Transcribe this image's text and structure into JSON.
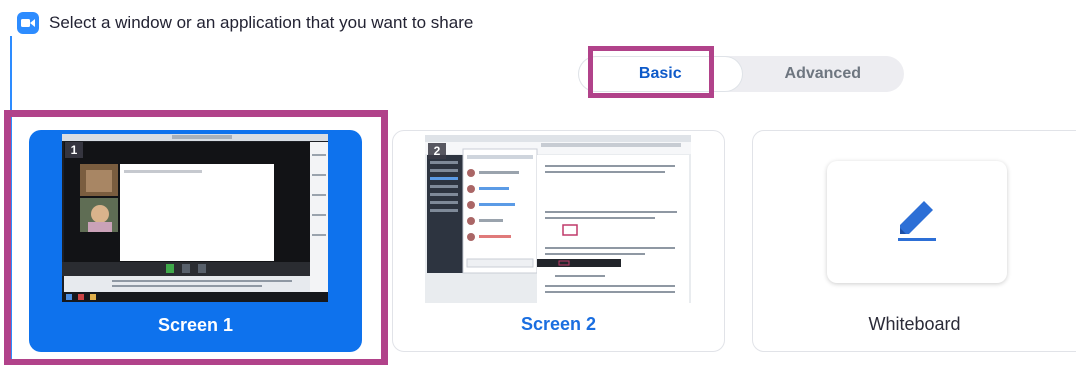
{
  "header": {
    "title": "Select a window or an application that you want to share"
  },
  "tabs": [
    {
      "label": "Basic",
      "active": true
    },
    {
      "label": "Advanced",
      "active": false
    }
  ],
  "cards": [
    {
      "label": "Screen 1",
      "number": "1",
      "selected": true
    },
    {
      "label": "Screen 2",
      "number": "2",
      "selected": false
    },
    {
      "label": "Whiteboard",
      "selected": false
    }
  ],
  "colors": {
    "accent": "#0e72ed",
    "highlight": "#b1428a",
    "zoom_blue": "#2d8cff"
  },
  "icons": {
    "app": "zoom-camera-icon",
    "whiteboard": "pen-icon"
  }
}
